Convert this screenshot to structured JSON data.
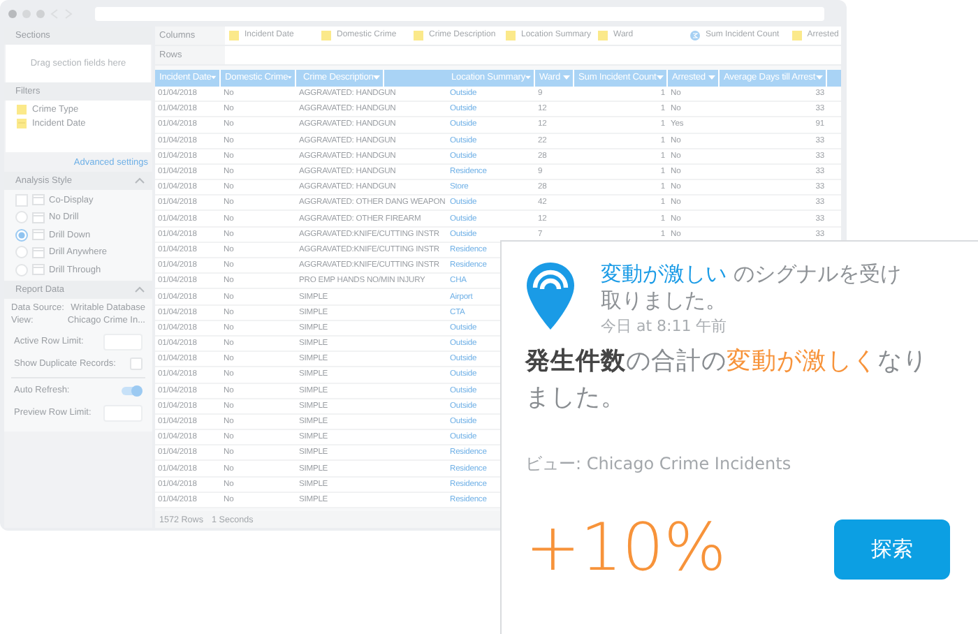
{
  "sidebar": {
    "sections": {
      "title": "Sections",
      "placeholder": "Drag section fields here"
    },
    "filters": {
      "title": "Filters",
      "items": [
        {
          "label": "Crime Type",
          "kind": "text"
        },
        {
          "label": "Incident Date",
          "kind": "date"
        }
      ]
    },
    "advanced_link": "Advanced settings",
    "analysis_style": {
      "title": "Analysis Style",
      "expanded": true,
      "options": [
        {
          "label": "Co-Display",
          "kind": "checkbox",
          "selected": false
        },
        {
          "label": "No Drill",
          "kind": "radio",
          "selected": false
        },
        {
          "label": "Drill Down",
          "kind": "radio",
          "selected": true
        },
        {
          "label": "Drill Anywhere",
          "kind": "radio",
          "selected": false
        },
        {
          "label": "Drill Through",
          "kind": "radio",
          "selected": false
        }
      ]
    },
    "report_data": {
      "title": "Report Data",
      "expanded": true,
      "fields": [
        {
          "label": "Data Source:",
          "value": "Writable Database"
        },
        {
          "label": "View:",
          "value": "Chicago Crime In..."
        }
      ],
      "settings": [
        {
          "label": "Active Row Limit:",
          "kind": "input"
        },
        {
          "label": "Show Duplicate Records:",
          "kind": "checkbox",
          "checked": false
        },
        {
          "label": "Auto Refresh:",
          "kind": "toggle",
          "on": true
        },
        {
          "label": "Preview Row Limit:",
          "kind": "input"
        }
      ]
    }
  },
  "toolbar": {
    "columns_label": "Columns",
    "column_fields": [
      {
        "label": "Incident Date",
        "kind": "dimension"
      },
      {
        "label": "Domestic Crime",
        "kind": "dimension"
      },
      {
        "label": "Crime Description",
        "kind": "dimension"
      },
      {
        "label": "Location Summary",
        "kind": "dimension"
      },
      {
        "label": "Ward",
        "kind": "dimension"
      },
      {
        "label": "Sum Incident Count",
        "kind": "measure"
      },
      {
        "label": "Arrested",
        "kind": "dimension"
      }
    ],
    "rows_label": "Rows"
  },
  "table": {
    "columns": [
      "Incident Date",
      "Domestic Crime",
      "Crime Description",
      "Location Summary",
      "Ward",
      "Sum Incident Count",
      "Arrested",
      "Average Days till Arrest"
    ],
    "rows": [
      [
        "01/04/2018",
        "No",
        "AGGRAVATED: HANDGUN",
        "Outside",
        "9",
        "1",
        "No",
        "33"
      ],
      [
        "01/04/2018",
        "No",
        "AGGRAVATED: HANDGUN",
        "Outside",
        "12",
        "1",
        "No",
        "33"
      ],
      [
        "01/04/2018",
        "No",
        "AGGRAVATED: HANDGUN",
        "Outside",
        "12",
        "1",
        "Yes",
        "91"
      ],
      [
        "01/04/2018",
        "No",
        "AGGRAVATED: HANDGUN",
        "Outside",
        "22",
        "1",
        "No",
        "33"
      ],
      [
        "01/04/2018",
        "No",
        "AGGRAVATED: HANDGUN",
        "Outside",
        "28",
        "1",
        "No",
        "33"
      ],
      [
        "01/04/2018",
        "No",
        "AGGRAVATED: HANDGUN",
        "Residence",
        "9",
        "1",
        "No",
        "33"
      ],
      [
        "01/04/2018",
        "No",
        "AGGRAVATED: HANDGUN",
        "Store",
        "28",
        "1",
        "No",
        "33"
      ],
      [
        "01/04/2018",
        "No",
        "AGGRAVATED: OTHER DANG WEAPON",
        "Outside",
        "42",
        "1",
        "No",
        "33"
      ],
      [
        "01/04/2018",
        "No",
        "AGGRAVATED: OTHER FIREARM",
        "Outside",
        "12",
        "1",
        "No",
        "33"
      ],
      [
        "01/04/2018",
        "No",
        "AGGRAVATED:KNIFE/CUTTING INSTR",
        "Outside",
        "7",
        "1",
        "No",
        "33"
      ],
      [
        "01/04/2018",
        "No",
        "AGGRAVATED:KNIFE/CUTTING INSTR",
        "Residence"
      ],
      [
        "01/04/2018",
        "No",
        "AGGRAVATED:KNIFE/CUTTING INSTR",
        "Residence"
      ],
      [
        "01/04/2018",
        "No",
        "PRO EMP HANDS NO/MIN INJURY",
        "CHA"
      ],
      [
        "01/04/2018",
        "No",
        "SIMPLE",
        "Airport"
      ],
      [
        "01/04/2018",
        "No",
        "SIMPLE",
        "CTA"
      ],
      [
        "01/04/2018",
        "No",
        "SIMPLE",
        "Outside"
      ],
      [
        "01/04/2018",
        "No",
        "SIMPLE",
        "Outside"
      ],
      [
        "01/04/2018",
        "No",
        "SIMPLE",
        "Outside"
      ],
      [
        "01/04/2018",
        "No",
        "SIMPLE",
        "Outside"
      ],
      [
        "01/04/2018",
        "No",
        "SIMPLE",
        "Outside"
      ],
      [
        "01/04/2018",
        "No",
        "SIMPLE",
        "Outside"
      ],
      [
        "01/04/2018",
        "No",
        "SIMPLE",
        "Outside"
      ],
      [
        "01/04/2018",
        "No",
        "SIMPLE",
        "Outside"
      ],
      [
        "01/04/2018",
        "No",
        "SIMPLE",
        "Residence"
      ],
      [
        "01/04/2018",
        "No",
        "SIMPLE",
        "Residence"
      ],
      [
        "01/04/2018",
        "No",
        "SIMPLE",
        "Residence"
      ],
      [
        "01/04/2018",
        "No",
        "SIMPLE",
        "Residence"
      ]
    ],
    "footer": {
      "row_count": "1572 Rows",
      "duration": "1 Seconds"
    }
  },
  "card": {
    "title_parts": [
      {
        "text": "変動が激しい",
        "kind": "highlight"
      },
      {
        "text": " のシグナルを受け取りました。",
        "kind": "plain"
      }
    ],
    "timestamp": "今日 at 8:11 午前",
    "message_parts": [
      {
        "text": "発生件数",
        "kind": "bold"
      },
      {
        "text": "の合計の",
        "kind": "plain"
      },
      {
        "text": "変動が激しく",
        "kind": "alert"
      },
      {
        "text": "なりました。",
        "kind": "plain"
      }
    ],
    "view_label": "ビュー: Chicago Crime Incidents",
    "change": "+10%",
    "button": "探索"
  }
}
